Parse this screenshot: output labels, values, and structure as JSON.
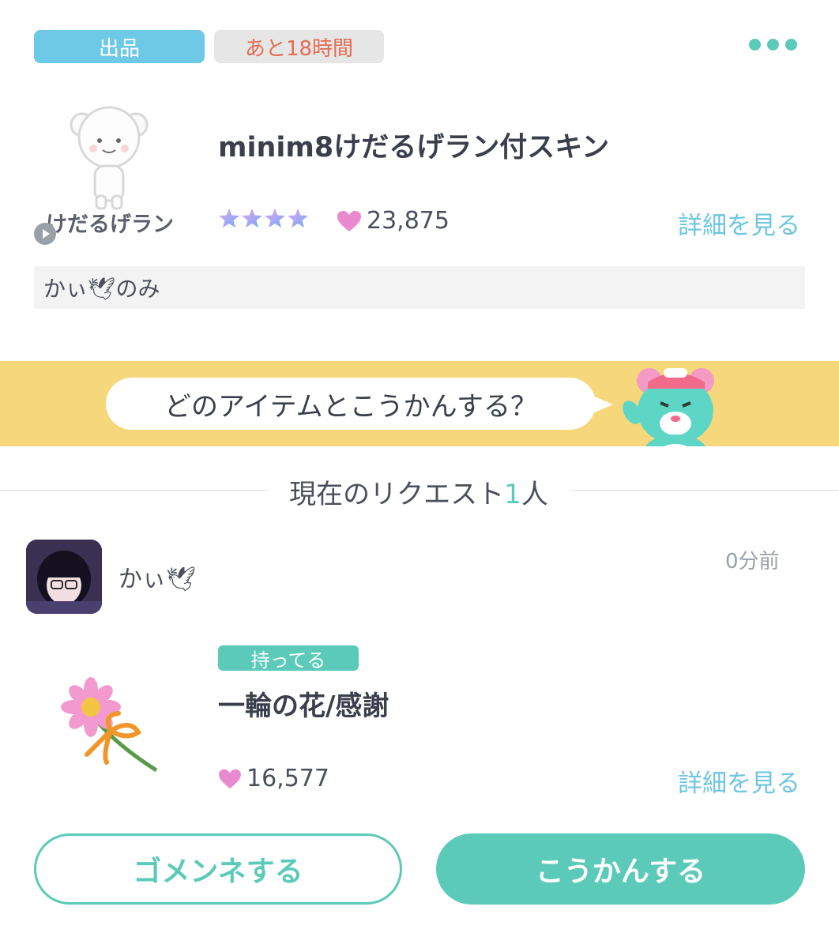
{
  "listing": {
    "type_tag": "出品",
    "time_tag": "あと18時間",
    "item_name_label": "けだるげラン",
    "title": "minim8けだるげラン付スキン",
    "rarity_stars": 4,
    "likes": "23,875",
    "detail_link": "詳細を見る",
    "note": "かぃ🕊のみ"
  },
  "banner": {
    "prompt": "どのアイテムとこうかんする？"
  },
  "requests": {
    "label_prefix": "現在のリクエスト",
    "count": "1",
    "label_suffix": "人",
    "items": [
      {
        "username": "かぃ🕊",
        "time": "0分前",
        "owned_tag": "持ってる",
        "item_title": "一輪の花/感謝",
        "likes": "16,577",
        "detail_link": "詳細を見る"
      }
    ]
  },
  "actions": {
    "decline_label": "ゴメンネする",
    "accept_label": "こうかんする"
  },
  "colors": {
    "accent_green": "#5ccab9",
    "accent_blue": "#6dc9e6",
    "time_red": "#e56b52",
    "banner_yellow": "#f6d77b",
    "heart_pink": "#e98ad0"
  },
  "icons": [
    "more-icon",
    "play-icon",
    "heart-icon",
    "star-icon",
    "bear-mascot",
    "flower-item",
    "character-item",
    "avatar"
  ]
}
